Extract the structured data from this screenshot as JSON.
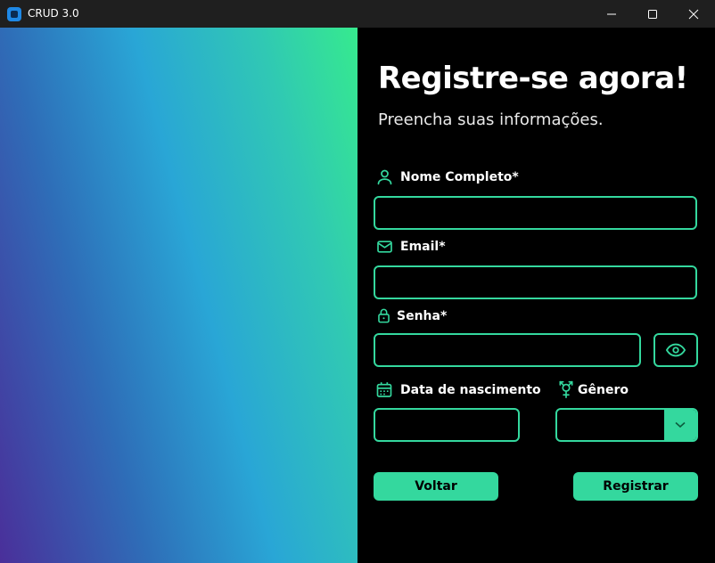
{
  "window": {
    "title": "CRUD 3.0",
    "controls": {
      "minimize_icon": "minimize-icon",
      "maximize_icon": "maximize-icon",
      "close_icon": "close-icon"
    }
  },
  "form": {
    "heading": "Registre-se agora!",
    "subheading": "Preencha suas informações.",
    "fields": {
      "full_name": {
        "label": "Nome Completo*",
        "icon": "user-icon",
        "value": ""
      },
      "email": {
        "label": "Email*",
        "icon": "envelope-icon",
        "value": ""
      },
      "password": {
        "label": "Senha*",
        "icon": "lock-icon",
        "value": "",
        "toggle_icon": "eye-icon"
      },
      "birth_date": {
        "label": "Data de nascimento",
        "icon": "calendar-icon",
        "value": ""
      },
      "gender": {
        "label": "Gênero",
        "icon": "gender-icon",
        "selected": "",
        "arrow_icon": "chevron-down-icon"
      }
    },
    "buttons": {
      "back": "Voltar",
      "register": "Registrar"
    }
  },
  "colors": {
    "accent": "#34d89e",
    "background": "#000000",
    "titlebar": "#1f1f1f",
    "gradient": [
      "#4a2f9a",
      "#2e6eb8",
      "#29a6d6",
      "#30c8b4",
      "#36ea8e"
    ]
  }
}
